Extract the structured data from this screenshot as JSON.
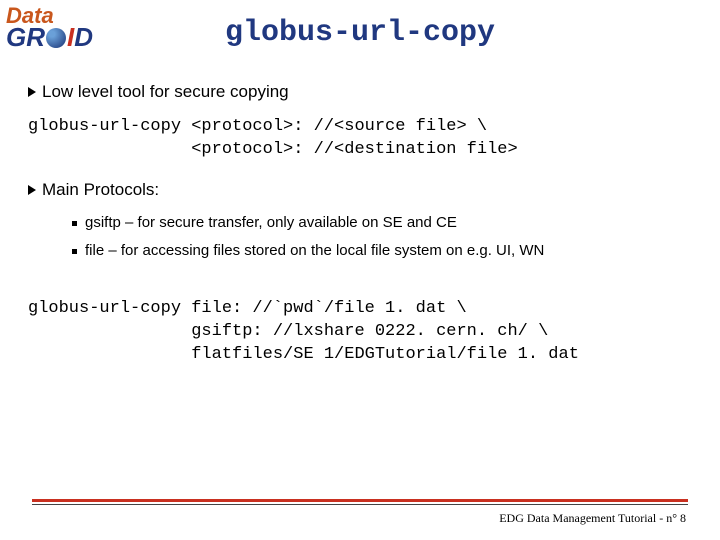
{
  "logo": {
    "top": "Data",
    "bottom_g": "G",
    "bottom_r": "R",
    "bottom_i": "I",
    "bottom_d": "D"
  },
  "title": "globus-url-copy",
  "bullets": {
    "b1": "Low level tool for secure copying",
    "code1_l1": "globus-url-copy <protocol>: //<source file> \\",
    "code1_l2": "                <protocol>: //<destination file>",
    "b2": "Main Protocols:",
    "sub1": "gsiftp – for secure transfer, only available on SE and CE",
    "sub2": "file – for accessing files stored on the local file system on e.g. UI, WN",
    "code2_l1": "globus-url-copy file: //`pwd`/file 1. dat \\",
    "code2_l2": "                gsiftp: //lxshare 0222. cern. ch/ \\",
    "code2_l3": "                flatfiles/SE 1/EDGTutorial/file 1. dat"
  },
  "footer": "EDG Data Management Tutorial - n° 8"
}
